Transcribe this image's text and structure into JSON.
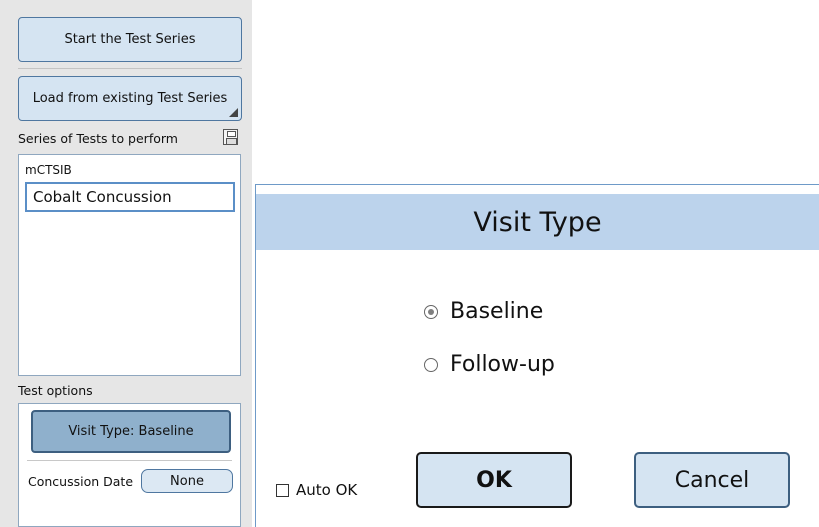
{
  "left_panel": {
    "start_button": "Start the Test Series",
    "load_button": "Load from existing Test Series",
    "series_label": "Series of Tests to perform",
    "series_list": {
      "items": [
        "mCTSIB",
        "Cobalt Concussion"
      ],
      "selected_index": 1
    },
    "test_options_label": "Test options",
    "visit_type_button": "Visit Type: Baseline",
    "concussion_date_label": "Concussion Date",
    "concussion_date_value": "None"
  },
  "dialog": {
    "title": "Visit Type",
    "options": [
      {
        "label": "Baseline",
        "selected": true
      },
      {
        "label": "Follow-up",
        "selected": false
      }
    ],
    "auto_ok_label": "Auto OK",
    "auto_ok_checked": false,
    "ok_label": "OK",
    "cancel_label": "Cancel"
  },
  "icons": {
    "save": "save-icon",
    "resize_corner": "corner-triangle-icon"
  }
}
